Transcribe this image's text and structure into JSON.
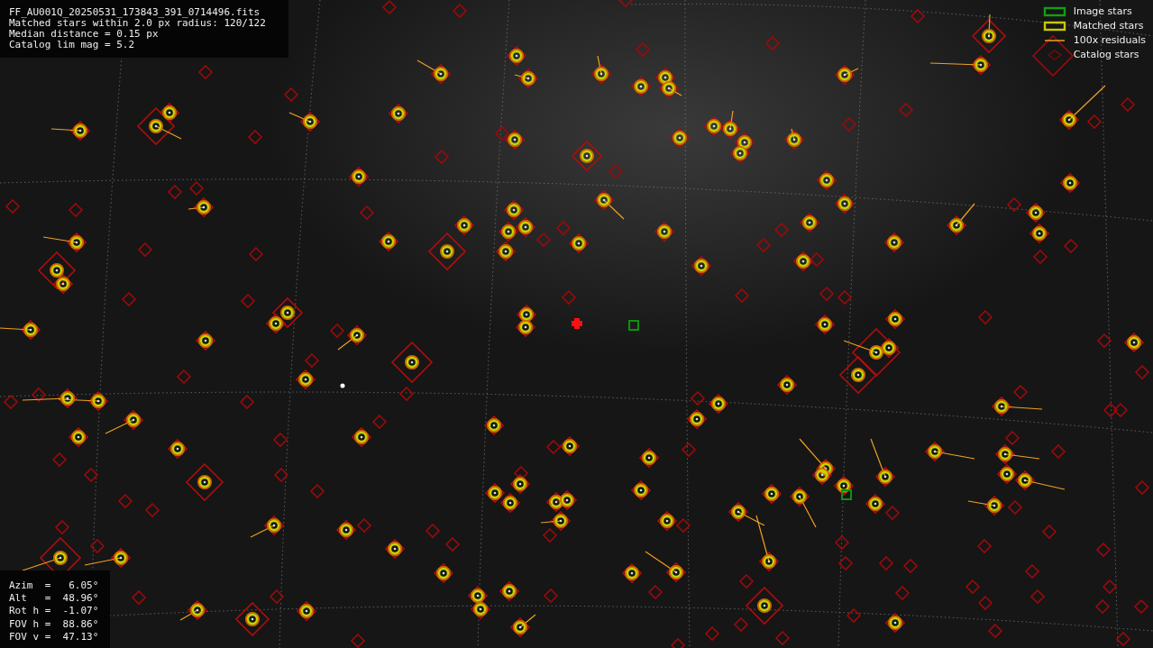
{
  "info": {
    "lines": [
      "FF_AU001Q_20250531_173843_391_0714496.fits",
      "Matched stars within 2.0 px radius: 120/122",
      "Median distance = 0.15 px",
      "Catalog lim mag = 5.2"
    ]
  },
  "legend": [
    {
      "kind": "image",
      "label": "Image stars"
    },
    {
      "kind": "matched",
      "label": "Matched stars"
    },
    {
      "kind": "residual",
      "label": "100x residuals"
    },
    {
      "kind": "catalog",
      "label": "Catalog stars"
    }
  ],
  "pointing": [
    "Azim  =   6.05°",
    "Alt   =  48.96°",
    "Rot h =  -1.07°",
    "FOV h =  88.86°",
    "FOV v =  47.13°"
  ]
}
